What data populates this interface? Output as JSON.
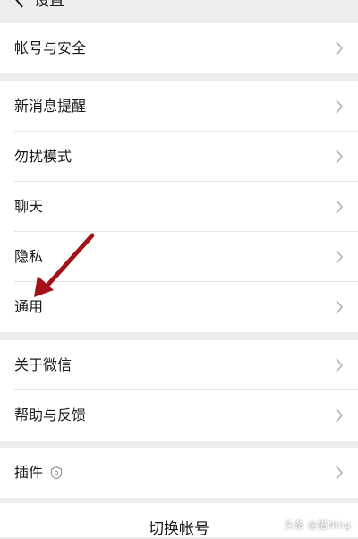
{
  "header": {
    "title": "设置"
  },
  "groups": [
    {
      "items": [
        {
          "label": "帐号与安全"
        }
      ]
    },
    {
      "items": [
        {
          "label": "新消息提醒"
        },
        {
          "label": "勿扰模式"
        },
        {
          "label": "聊天"
        },
        {
          "label": "隐私"
        },
        {
          "label": "通用"
        }
      ]
    },
    {
      "items": [
        {
          "label": "关于微信"
        },
        {
          "label": "帮助与反馈"
        }
      ]
    },
    {
      "items": [
        {
          "label": "插件"
        }
      ]
    }
  ],
  "footer": {
    "switch_account": "切换帐号"
  },
  "watermark": "头条 @猫Ning",
  "colors": {
    "background": "#ededed",
    "row": "#ffffff",
    "text": "#191919",
    "chevron": "#b2b2b2",
    "annotation_arrow": "#a3111a"
  },
  "icons": [
    "back-arrow-icon",
    "chevron-right-icon",
    "plugin-shield-icon"
  ]
}
